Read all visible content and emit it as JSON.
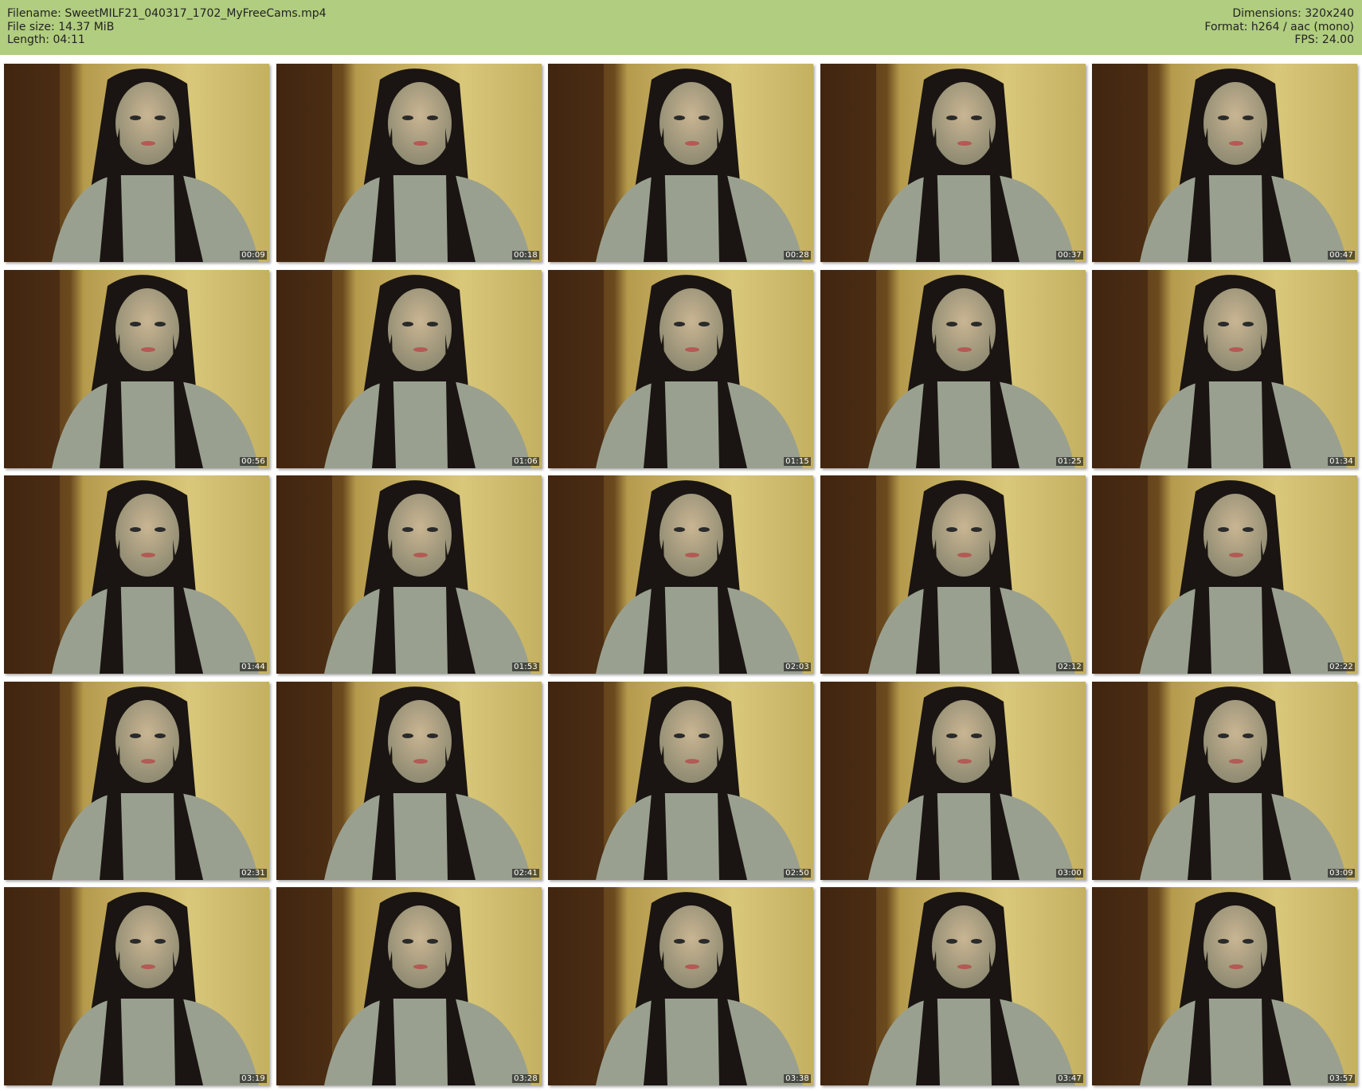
{
  "header": {
    "filename_label": "Filename:",
    "filename": "SweetMILF21_040317_1702_MyFreeCams.mp4",
    "filesize_label": "File size:",
    "filesize": "14.37 MiB",
    "length_label": "Length:",
    "length": "04:11",
    "dimensions_label": "Dimensions:",
    "dimensions": "320x240",
    "format_label": "Format:",
    "format": "h264 / aac (mono)",
    "fps_label": "FPS:",
    "fps": "24.00",
    "background_color": "#b1cd7f"
  },
  "thumbnails": [
    {
      "timestamp": "00:09"
    },
    {
      "timestamp": "00:18"
    },
    {
      "timestamp": "00:28"
    },
    {
      "timestamp": "00:37"
    },
    {
      "timestamp": "00:47"
    },
    {
      "timestamp": "00:56"
    },
    {
      "timestamp": "01:06"
    },
    {
      "timestamp": "01:15"
    },
    {
      "timestamp": "01:25"
    },
    {
      "timestamp": "01:34"
    },
    {
      "timestamp": "01:44"
    },
    {
      "timestamp": "01:53"
    },
    {
      "timestamp": "02:03"
    },
    {
      "timestamp": "02:12"
    },
    {
      "timestamp": "02:22"
    },
    {
      "timestamp": "02:31"
    },
    {
      "timestamp": "02:41"
    },
    {
      "timestamp": "02:50"
    },
    {
      "timestamp": "03:00"
    },
    {
      "timestamp": "03:09"
    },
    {
      "timestamp": "03:19"
    },
    {
      "timestamp": "03:28"
    },
    {
      "timestamp": "03:38"
    },
    {
      "timestamp": "03:47"
    },
    {
      "timestamp": "03:57"
    }
  ]
}
